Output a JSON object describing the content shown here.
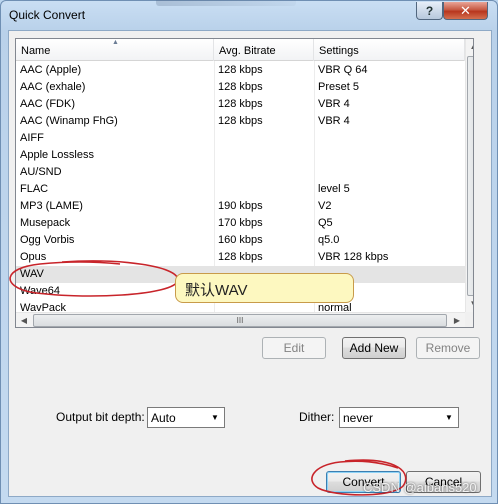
{
  "window": {
    "title": "Quick Convert",
    "help_label": "?",
    "close_label": "✕"
  },
  "list": {
    "columns": [
      "Name",
      "Avg. Bitrate",
      "Settings"
    ],
    "rows": [
      {
        "name": "AAC (Apple)",
        "bitrate": "128 kbps",
        "settings": "VBR Q 64"
      },
      {
        "name": "AAC (exhale)",
        "bitrate": "128 kbps",
        "settings": "Preset 5"
      },
      {
        "name": "AAC (FDK)",
        "bitrate": "128 kbps",
        "settings": "VBR 4"
      },
      {
        "name": "AAC (Winamp FhG)",
        "bitrate": "128 kbps",
        "settings": "VBR 4"
      },
      {
        "name": "AIFF",
        "bitrate": "",
        "settings": ""
      },
      {
        "name": "Apple Lossless",
        "bitrate": "",
        "settings": ""
      },
      {
        "name": "AU/SND",
        "bitrate": "",
        "settings": ""
      },
      {
        "name": "FLAC",
        "bitrate": "",
        "settings": "level 5"
      },
      {
        "name": "MP3 (LAME)",
        "bitrate": "190 kbps",
        "settings": "V2"
      },
      {
        "name": "Musepack",
        "bitrate": "170 kbps",
        "settings": "Q5"
      },
      {
        "name": "Ogg Vorbis",
        "bitrate": "160 kbps",
        "settings": "q5.0"
      },
      {
        "name": "Opus",
        "bitrate": "128 kbps",
        "settings": "VBR 128 kbps"
      },
      {
        "name": "WAV",
        "bitrate": "",
        "settings": ""
      },
      {
        "name": "Wave64",
        "bitrate": "",
        "settings": ""
      },
      {
        "name": "WavPack",
        "bitrate": "",
        "settings": "normal"
      }
    ],
    "selected_row": "WAV",
    "hscroll_grip": "III"
  },
  "buttons": {
    "edit": "Edit",
    "add_new": "Add New",
    "remove": "Remove",
    "convert": "Convert",
    "cancel": "Cancel"
  },
  "options": {
    "bit_depth_label": "Output bit depth:",
    "bit_depth_value": "Auto",
    "dither_label": "Dither:",
    "dither_value": "never"
  },
  "annotation": {
    "callout_text": "默认WAV"
  },
  "watermark": "CSDN @aibans520",
  "colors": {
    "annotation_red": "#c8242a",
    "selection": "#e4e4e4"
  }
}
